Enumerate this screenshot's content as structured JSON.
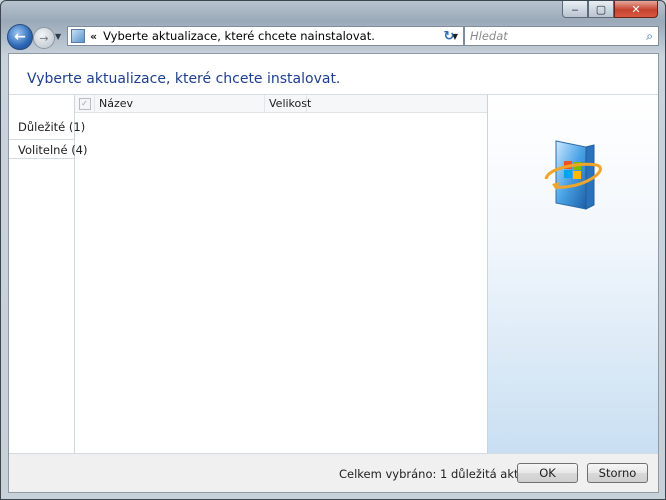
{
  "window": {
    "caption_buttons": {
      "minimize": "‒",
      "maximize": "▢",
      "close": "✕"
    }
  },
  "navbar": {
    "back_icon": "back-arrow-icon",
    "forward_icon": "forward-arrow-icon",
    "address_prefix": "«",
    "address_text": "Vyberte aktualizace, které chcete nainstalovat.",
    "search_placeholder": "Hledat"
  },
  "page": {
    "heading": "Vyberte aktualizace, které chcete instalovat.",
    "categories": [
      {
        "label": "Důležité (1)",
        "selected": false
      },
      {
        "label": "Volitelné (4)",
        "selected": true
      }
    ],
    "columns": {
      "name": "Název",
      "size": "Velikost"
    },
    "summary": "Celkem vybráno: 1 důležitá aktualizace",
    "ok_label": "OK",
    "cancel_label": "Storno"
  },
  "colors": {
    "heading": "#1e3f8e",
    "close_button": "#c4432f",
    "right_pane_gradient_end": "#c9dff2"
  }
}
